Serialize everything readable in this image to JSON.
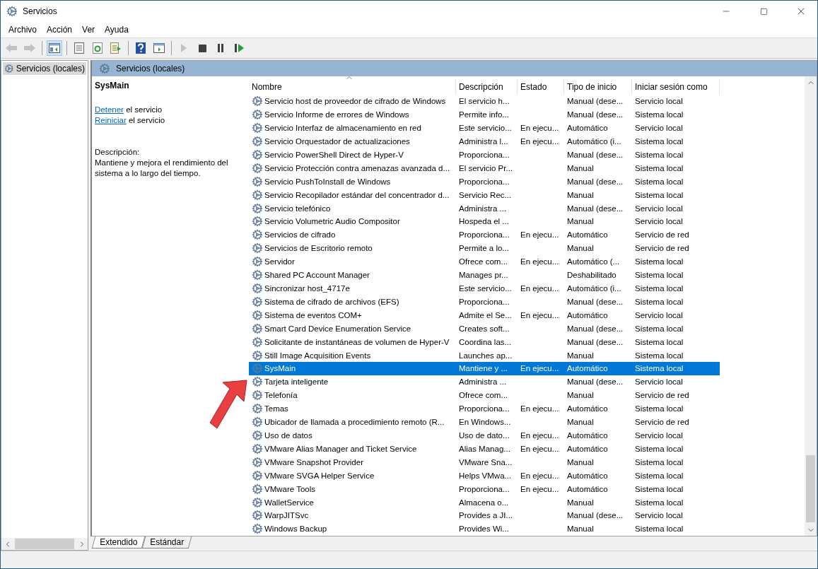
{
  "window": {
    "title": "Servicios"
  },
  "menu": [
    {
      "label": "Archivo"
    },
    {
      "label": "Acción"
    },
    {
      "label": "Ver"
    },
    {
      "label": "Ayuda"
    }
  ],
  "toolbar": [
    {
      "kind": "back",
      "disabled": true,
      "pressed": false
    },
    {
      "kind": "forward",
      "disabled": true,
      "pressed": false
    },
    {
      "kind": "sep"
    },
    {
      "kind": "tree",
      "disabled": false,
      "pressed": true
    },
    {
      "kind": "sep"
    },
    {
      "kind": "properties",
      "disabled": false,
      "pressed": false
    },
    {
      "kind": "refresh",
      "disabled": false,
      "pressed": false
    },
    {
      "kind": "export",
      "disabled": false,
      "pressed": false
    },
    {
      "kind": "sep"
    },
    {
      "kind": "help",
      "disabled": false,
      "pressed": false
    },
    {
      "kind": "view",
      "disabled": false,
      "pressed": false
    },
    {
      "kind": "sep"
    },
    {
      "kind": "start",
      "disabled": true,
      "pressed": false
    },
    {
      "kind": "stop",
      "disabled": false,
      "pressed": false
    },
    {
      "kind": "pause",
      "disabled": false,
      "pressed": false
    },
    {
      "kind": "resume",
      "disabled": false,
      "pressed": false
    }
  ],
  "tree": {
    "items": [
      {
        "label": "Servicios (locales)",
        "selected": true
      }
    ]
  },
  "pane": {
    "title": "Servicios (locales)",
    "details": {
      "service": "SysMain",
      "actions": [
        {
          "link": "Detener",
          "text": "el servicio"
        },
        {
          "link": "Reiniciar",
          "text": "el servicio"
        }
      ],
      "description_label": "Descripción:",
      "description": "Mantiene y mejora el rendimiento del sistema a lo largo del tiempo."
    },
    "table": {
      "columns": [
        "Nombre",
        "Descripción",
        "Estado",
        "Tipo de inicio",
        "Iniciar sesión como"
      ],
      "rows": [
        {
          "name": "Servicio host de proveedor de cifrado de Windows",
          "description": "El servicio h...",
          "status": "",
          "startup": "Manual (dese...",
          "logon": "Servicio local",
          "selected": false
        },
        {
          "name": "Servicio Informe de errores de Windows",
          "description": "Permite info...",
          "status": "",
          "startup": "Manual (dese...",
          "logon": "Sistema local",
          "selected": false
        },
        {
          "name": "Servicio Interfaz de almacenamiento en red",
          "description": "Este servicio...",
          "status": "En ejecu...",
          "startup": "Automático",
          "logon": "Servicio local",
          "selected": false
        },
        {
          "name": "Servicio Orquestador de actualizaciones",
          "description": "Administra l...",
          "status": "En ejecu...",
          "startup": "Automático (i...",
          "logon": "Sistema local",
          "selected": false
        },
        {
          "name": "Servicio PowerShell Direct de Hyper-V",
          "description": "Proporciona...",
          "status": "",
          "startup": "Manual (dese...",
          "logon": "Sistema local",
          "selected": false
        },
        {
          "name": "Servicio Protección contra amenazas avanzada d...",
          "description": "El servicio Pr...",
          "status": "",
          "startup": "Manual",
          "logon": "Sistema local",
          "selected": false
        },
        {
          "name": "Servicio PushToInstall de Windows",
          "description": "Proporciona...",
          "status": "",
          "startup": "Manual (dese...",
          "logon": "Sistema local",
          "selected": false
        },
        {
          "name": "Servicio Recopilador estándar del concentrador d...",
          "description": "Servicio Rec...",
          "status": "",
          "startup": "Manual",
          "logon": "Sistema local",
          "selected": false
        },
        {
          "name": "Servicio telefónico",
          "description": "Administra ...",
          "status": "",
          "startup": "Manual (dese...",
          "logon": "Servicio local",
          "selected": false
        },
        {
          "name": "Servicio Volumetric Audio Compositor",
          "description": "Hospeda el ...",
          "status": "",
          "startup": "Manual",
          "logon": "Servicio local",
          "selected": false
        },
        {
          "name": "Servicios de cifrado",
          "description": "Proporciona...",
          "status": "En ejecu...",
          "startup": "Automático",
          "logon": "Servicio de red",
          "selected": false
        },
        {
          "name": "Servicios de Escritorio remoto",
          "description": "Permite a lo...",
          "status": "",
          "startup": "Manual",
          "logon": "Servicio de red",
          "selected": false
        },
        {
          "name": "Servidor",
          "description": "Ofrece com...",
          "status": "En ejecu...",
          "startup": "Automático (...",
          "logon": "Sistema local",
          "selected": false
        },
        {
          "name": "Shared PC Account Manager",
          "description": "Manages pr...",
          "status": "",
          "startup": "Deshabilitado",
          "logon": "Sistema local",
          "selected": false
        },
        {
          "name": "Sincronizar host_4717e",
          "description": "Este servicio...",
          "status": "En ejecu...",
          "startup": "Automático (i...",
          "logon": "Sistema local",
          "selected": false
        },
        {
          "name": "Sistema de cifrado de archivos (EFS)",
          "description": "Proporciona...",
          "status": "",
          "startup": "Manual (dese...",
          "logon": "Sistema local",
          "selected": false
        },
        {
          "name": "Sistema de eventos COM+",
          "description": "Admite el Se...",
          "status": "En ejecu...",
          "startup": "Automático",
          "logon": "Servicio local",
          "selected": false
        },
        {
          "name": "Smart Card Device Enumeration Service",
          "description": "Creates soft...",
          "status": "",
          "startup": "Manual (dese...",
          "logon": "Sistema local",
          "selected": false
        },
        {
          "name": "Solicitante de instantáneas de volumen de Hyper-V",
          "description": "Coordina las...",
          "status": "",
          "startup": "Manual (dese...",
          "logon": "Sistema local",
          "selected": false
        },
        {
          "name": "Still Image Acquisition Events",
          "description": "Launches ap...",
          "status": "",
          "startup": "Manual",
          "logon": "Sistema local",
          "selected": false
        },
        {
          "name": "SysMain",
          "description": "Mantiene y ...",
          "status": "En ejecu...",
          "startup": "Automático",
          "logon": "Sistema local",
          "selected": true
        },
        {
          "name": "Tarjeta inteligente",
          "description": "Administra ...",
          "status": "",
          "startup": "Manual (dese...",
          "logon": "Servicio local",
          "selected": false
        },
        {
          "name": "Telefonía",
          "description": "Ofrece com...",
          "status": "",
          "startup": "Manual",
          "logon": "Servicio de red",
          "selected": false
        },
        {
          "name": "Temas",
          "description": "Proporciona...",
          "status": "En ejecu...",
          "startup": "Automático",
          "logon": "Sistema local",
          "selected": false
        },
        {
          "name": "Ubicador de llamada a procedimiento remoto (R...",
          "description": "En Windows...",
          "status": "",
          "startup": "Manual",
          "logon": "Servicio de red",
          "selected": false
        },
        {
          "name": "Uso de datos",
          "description": "Uso de dato...",
          "status": "En ejecu...",
          "startup": "Automático",
          "logon": "Servicio local",
          "selected": false
        },
        {
          "name": "VMware Alias Manager and Ticket Service",
          "description": "Alias Manag...",
          "status": "En ejecu...",
          "startup": "Automático",
          "logon": "Sistema local",
          "selected": false
        },
        {
          "name": "VMware Snapshot Provider",
          "description": "VMware Sna...",
          "status": "",
          "startup": "Manual",
          "logon": "Sistema local",
          "selected": false
        },
        {
          "name": "VMware SVGA Helper Service",
          "description": "Helps VMwa...",
          "status": "En ejecu...",
          "startup": "Automático",
          "logon": "Sistema local",
          "selected": false
        },
        {
          "name": "VMware Tools",
          "description": "Proporciona...",
          "status": "En ejecu...",
          "startup": "Automático",
          "logon": "Sistema local",
          "selected": false
        },
        {
          "name": "WalletService",
          "description": "Almacena o...",
          "status": "",
          "startup": "Manual",
          "logon": "Sistema local",
          "selected": false
        },
        {
          "name": "WarpJITSvc",
          "description": "Provides a JI...",
          "status": "",
          "startup": "Manual (dese...",
          "logon": "Servicio local",
          "selected": false
        },
        {
          "name": "Windows Backup",
          "description": "Provides Wi...",
          "status": "",
          "startup": "Manual",
          "logon": "Sistema local",
          "selected": false
        }
      ]
    }
  },
  "view_tabs": [
    {
      "label": "Extendido",
      "selected": true
    },
    {
      "label": "Estándar",
      "selected": false
    }
  ]
}
